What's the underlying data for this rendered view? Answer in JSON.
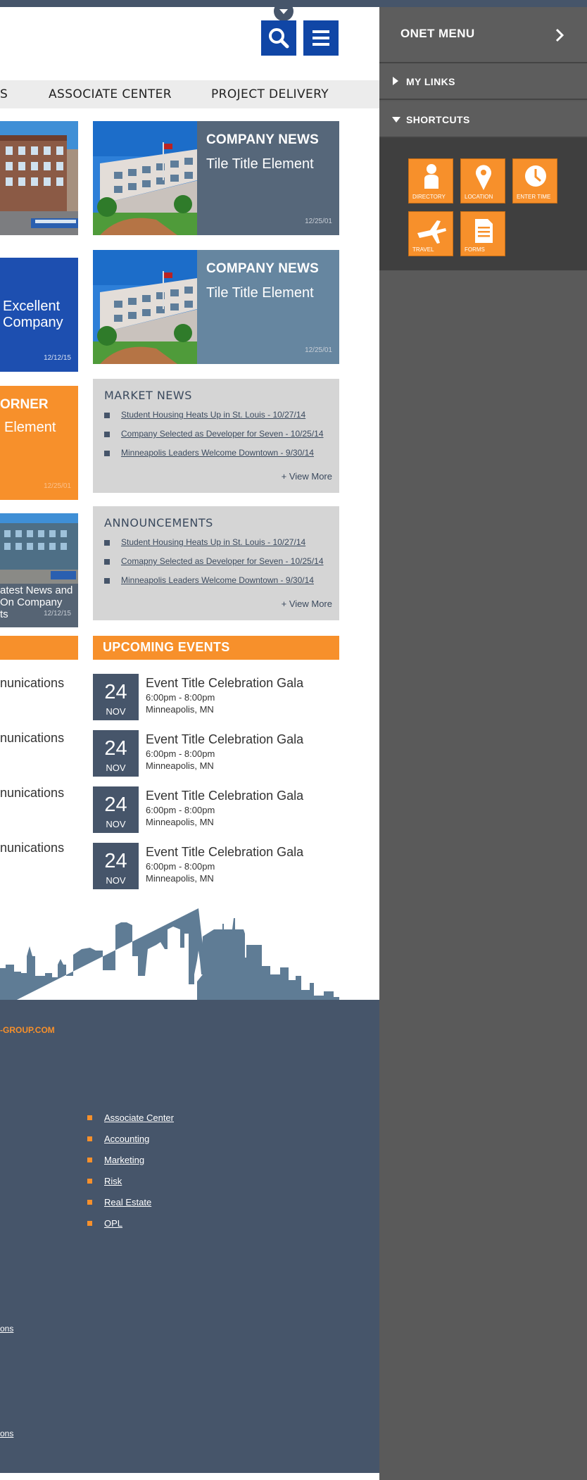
{
  "header": {
    "search_icon": "search-icon",
    "menu_icon": "hamburger-menu-icon"
  },
  "nav": {
    "items": [
      "S",
      "ASSOCIATE CENTER",
      "PROJECT DELIVERY"
    ]
  },
  "tiles": {
    "left_blue": {
      "title": "Excellent Company",
      "line1": "Excellent",
      "line2": "Company",
      "date": "12/12/15"
    },
    "left_orange": {
      "category": "ORNER",
      "title": "Element",
      "date": "12/25/01"
    },
    "left_photo": {
      "line1": "atest News and",
      "line2": "On Company",
      "line3": "ts",
      "date": "12/12/15"
    },
    "news": [
      {
        "category": "COMPANY NEWS",
        "title": "Tile Title Element",
        "date": "12/25/01"
      },
      {
        "category": "COMPANY NEWS",
        "title": "Tile Title Element",
        "date": "12/25/01"
      }
    ]
  },
  "market_news": {
    "heading": "MARKET NEWS",
    "items": [
      "Student Housing Heats Up in St. Louis - 10/27/14",
      "Company Selected as Developer for Seven - 10/25/14",
      "Minneapolis Leaders Welcome Downtown - 9/30/14"
    ],
    "more": "+  View More"
  },
  "announcements": {
    "heading": "ANNOUNCEMENTS",
    "items": [
      "Student Housing Heats Up in St. Louis - 10/27/14",
      "Comapny Selected as Developer for Seven - 10/25/14",
      "Minneapolis Leaders Welcome Downtown - 9/30/14"
    ],
    "more": "+  View More"
  },
  "communications": {
    "items": [
      "nunications",
      "nunications",
      "nunications",
      "nunications"
    ]
  },
  "events": {
    "heading": "UPCOMING EVENTS",
    "items": [
      {
        "day": "24",
        "month": "NOV",
        "title": "Event Title Celebration Gala",
        "time": "6:00pm - 8:00pm",
        "location": "Minneapolis, MN"
      },
      {
        "day": "24",
        "month": "NOV",
        "title": "Event Title Celebration Gala",
        "time": "6:00pm - 8:00pm",
        "location": "Minneapolis, MN"
      },
      {
        "day": "24",
        "month": "NOV",
        "title": "Event Title Celebration Gala",
        "time": "6:00pm - 8:00pm",
        "location": "Minneapolis, MN"
      },
      {
        "day": "24",
        "month": "NOV",
        "title": "Event Title Celebration Gala",
        "time": "6:00pm - 8:00pm",
        "location": "Minneapolis, MN"
      }
    ]
  },
  "footer": {
    "domain": "-GROUP.COM",
    "links": [
      "Associate Center",
      "Accounting",
      "Marketing",
      "Risk",
      "Real Estate",
      "OPL"
    ],
    "fragments": [
      "ons",
      "ons"
    ]
  },
  "sidebar": {
    "title": "ONET MENU",
    "sections": [
      "MY LINKS",
      "SHORTCUTS"
    ],
    "shortcuts": [
      {
        "label": "DIRECTORY",
        "icon": "person-icon"
      },
      {
        "label": "LOCATION",
        "icon": "map-pin-icon"
      },
      {
        "label": "ENTER TIME",
        "icon": "clock-icon"
      },
      {
        "label": "TRAVEL",
        "icon": "airplane-icon"
      },
      {
        "label": "FORMS",
        "icon": "document-icon"
      }
    ]
  },
  "colors": {
    "brand_blue": "#1046a6",
    "slate": "#46556a",
    "orange": "#f7902b",
    "gray_panel": "#d5d5d5",
    "sidebar": "#5a5a5a"
  }
}
